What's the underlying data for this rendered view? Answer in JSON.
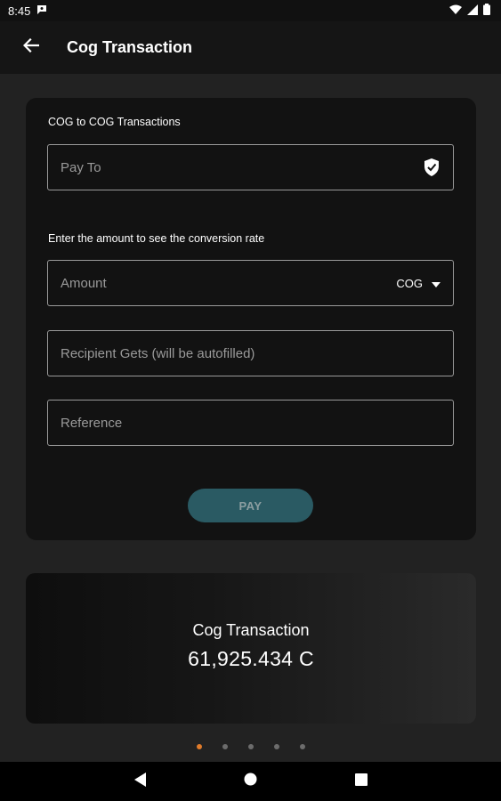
{
  "status_bar": {
    "time": "8:45",
    "icons": [
      "notification-icon",
      "wifi-icon",
      "signal-icon",
      "battery-icon"
    ]
  },
  "app_bar": {
    "title": "Cog Transaction",
    "back_icon": "arrow-back-icon"
  },
  "form": {
    "section_title": "COG to COG Transactions",
    "pay_to": {
      "placeholder": "Pay To",
      "value": "",
      "icon": "verified-shield-icon"
    },
    "conversion_hint": "Enter the amount to see the conversion rate",
    "amount": {
      "placeholder": "Amount",
      "value": "",
      "currency": "COG",
      "dropdown_icon": "dropdown-arrow-icon"
    },
    "recipient_gets": {
      "placeholder": "Recipient Gets (will be autofilled)",
      "value": ""
    },
    "reference": {
      "placeholder": "Reference",
      "value": ""
    },
    "pay_button": "PAY"
  },
  "balance_card": {
    "title": "Cog Transaction",
    "amount": "61,925.434 C"
  },
  "pager": {
    "count": 5,
    "active_index": 0
  },
  "nav_bar": {
    "icons": [
      "back-triangle-icon",
      "home-circle-icon",
      "recents-square-icon"
    ]
  },
  "colors": {
    "background": "#222222",
    "card": "#121212",
    "accent_button": "#2a5a63",
    "active_dot": "#e07b2a"
  }
}
